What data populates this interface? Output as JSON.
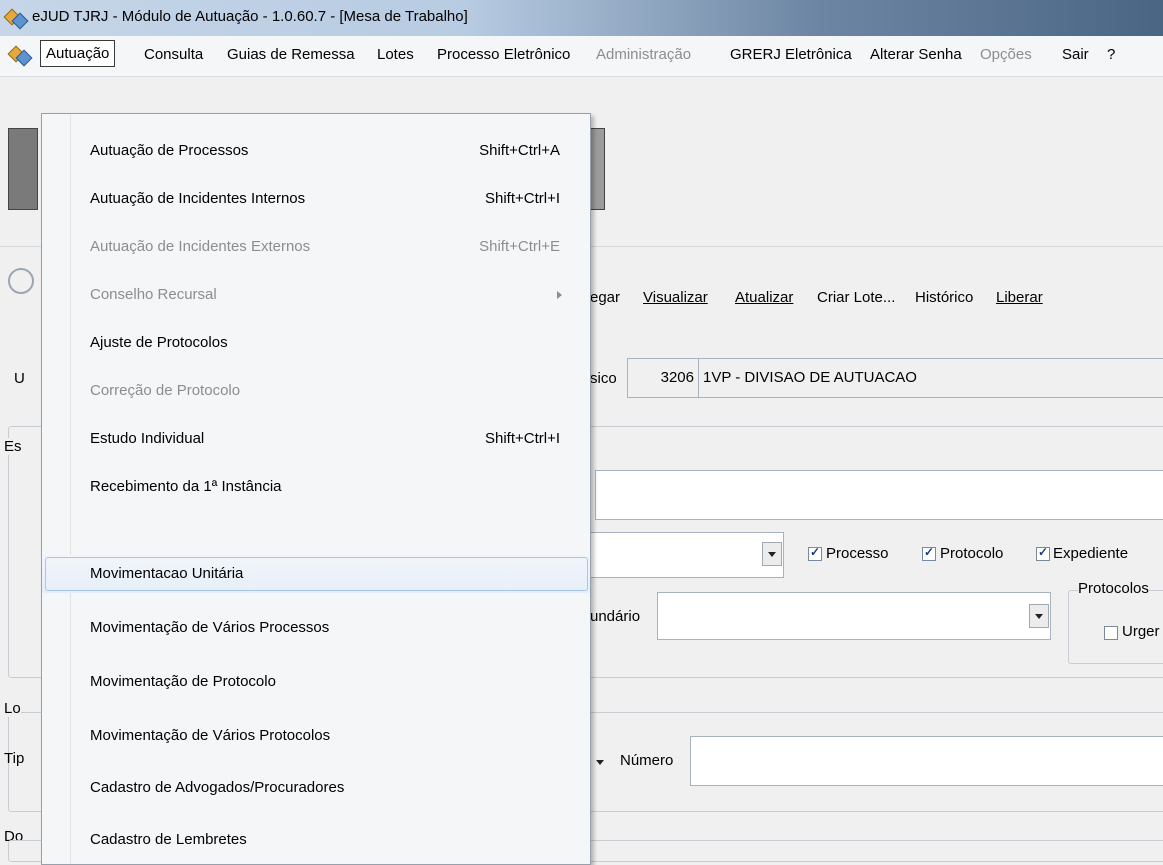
{
  "window": {
    "title": "eJUD TJRJ - Módulo de Autuação - 1.0.60.7 - [Mesa de Trabalho]"
  },
  "menubar": [
    {
      "label": "Autuação",
      "enabled": true
    },
    {
      "label": "Consulta",
      "enabled": true
    },
    {
      "label": "Guias de Remessa",
      "enabled": true
    },
    {
      "label": "Lotes",
      "enabled": true
    },
    {
      "label": "Processo Eletrônico",
      "enabled": true
    },
    {
      "label": "Administração",
      "enabled": false
    },
    {
      "label": "GRERJ Eletrônica",
      "enabled": true
    },
    {
      "label": "Alterar Senha",
      "enabled": true
    },
    {
      "label": "Opções",
      "enabled": false
    },
    {
      "label": "Sair",
      "enabled": true
    },
    {
      "label": "?",
      "enabled": true
    }
  ],
  "dropdown": [
    {
      "label": "Autuação de Processos",
      "shortcut": "Shift+Ctrl+A",
      "enabled": true
    },
    {
      "label": "Autuação de Incidentes Internos",
      "shortcut": "Shift+Ctrl+I",
      "enabled": true
    },
    {
      "label": "Autuação de Incidentes Externos",
      "shortcut": "Shift+Ctrl+E",
      "enabled": false
    },
    {
      "label": "Conselho Recursal",
      "shortcut": "",
      "enabled": false,
      "submenu": true
    },
    {
      "label": "Ajuste de Protocolos",
      "shortcut": "",
      "enabled": true
    },
    {
      "label": "Correção de Protocolo",
      "shortcut": "",
      "enabled": false
    },
    {
      "label": "Estudo Individual",
      "shortcut": "Shift+Ctrl+I",
      "enabled": true
    },
    {
      "label": "Recebimento da 1ª Instância",
      "shortcut": "",
      "enabled": true
    },
    {
      "label": "Movimentacao Unitária",
      "shortcut": "",
      "enabled": true,
      "highlighted": true
    },
    {
      "label": "Movimentação de Vários Processos",
      "shortcut": "",
      "enabled": true
    },
    {
      "label": "Movimentação de Protocolo",
      "shortcut": "",
      "enabled": true
    },
    {
      "label": "Movimentação de Vários Protocolos",
      "shortcut": "",
      "enabled": true
    },
    {
      "label": "Cadastro de Advogados/Procuradores",
      "shortcut": "",
      "enabled": true
    },
    {
      "label": "Cadastro de Lembretes",
      "shortcut": "",
      "enabled": true
    }
  ],
  "toolbar_links": [
    "egar",
    "Visualizar",
    "Atualizar",
    "Criar Lote...",
    "Histórico",
    "Liberar"
  ],
  "location": {
    "label_partial": "sico",
    "code": "3206",
    "name": "1VP - DIVISAO DE AUTUACAO"
  },
  "left_labels": {
    "u": "U",
    "es": "Es",
    "lo": "Lo",
    "tip": "Tip",
    "do": "Do"
  },
  "filters": {
    "processo": {
      "label": "Processo",
      "checked": true
    },
    "protocolo": {
      "label": "Protocolo",
      "checked": true
    },
    "expediente": {
      "label": "Expediente",
      "checked": true
    },
    "secundario_label": "undário",
    "protocolos_group": "Protocolos",
    "urgente": {
      "label": "Urger",
      "checked": false
    }
  },
  "numero_label": "Número"
}
